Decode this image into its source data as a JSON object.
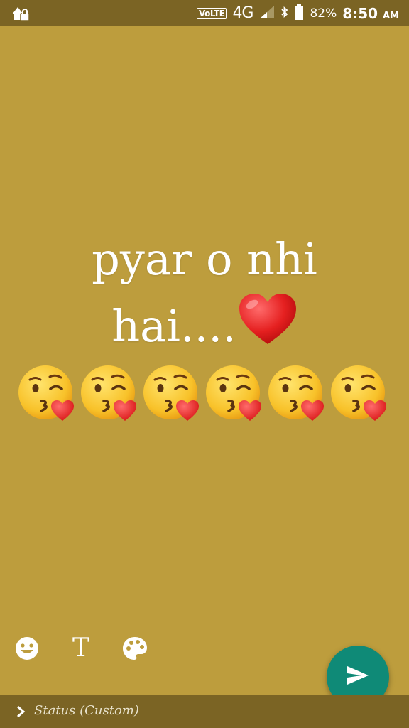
{
  "status_bar": {
    "volte": "VoLTE",
    "network": "4G",
    "battery": "82%",
    "time": "8:50",
    "ampm": "AM",
    "icons": [
      "notification-icon",
      "signal-icon",
      "bluetooth-icon",
      "battery-icon"
    ]
  },
  "status_post": {
    "line1": "pyar o nhi",
    "line2": "hai....",
    "heart": "red-heart-emoji",
    "emojis": [
      "kissing-face-emoji",
      "kissing-face-emoji",
      "kissing-face-emoji",
      "kissing-face-emoji",
      "kissing-face-emoji",
      "kissing-face-emoji"
    ],
    "background_color": "#bd9d3d"
  },
  "toolbar": {
    "emoji_button": "smiley-icon",
    "text_button": "T",
    "color_button": "palette-icon"
  },
  "send_button": {
    "icon": "send-icon",
    "color": "#0f8a77"
  },
  "privacy_bar": {
    "label": "Status (Custom)"
  }
}
